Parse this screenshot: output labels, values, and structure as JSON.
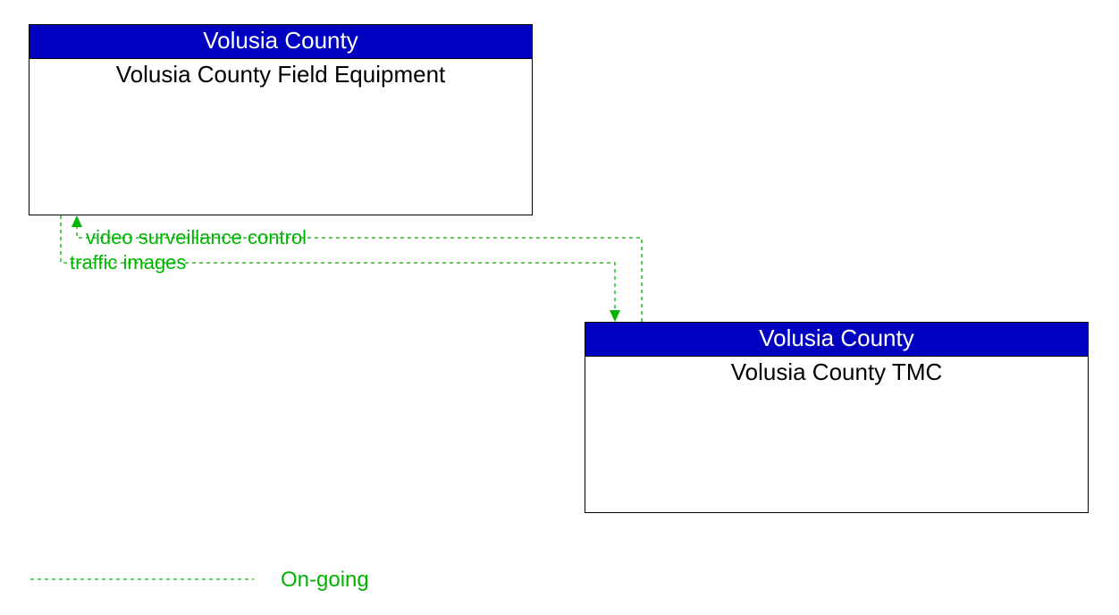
{
  "entities": {
    "top": {
      "header": "Volusia County",
      "body": "Volusia County Field Equipment"
    },
    "bottom": {
      "header": "Volusia County",
      "body": "Volusia County TMC"
    }
  },
  "flows": {
    "to_top": "video surveillance control",
    "to_bottom": "traffic images"
  },
  "legend": {
    "ongoing": "On-going"
  },
  "colors": {
    "header_bg": "#0000c0",
    "flow": "#00b400"
  }
}
